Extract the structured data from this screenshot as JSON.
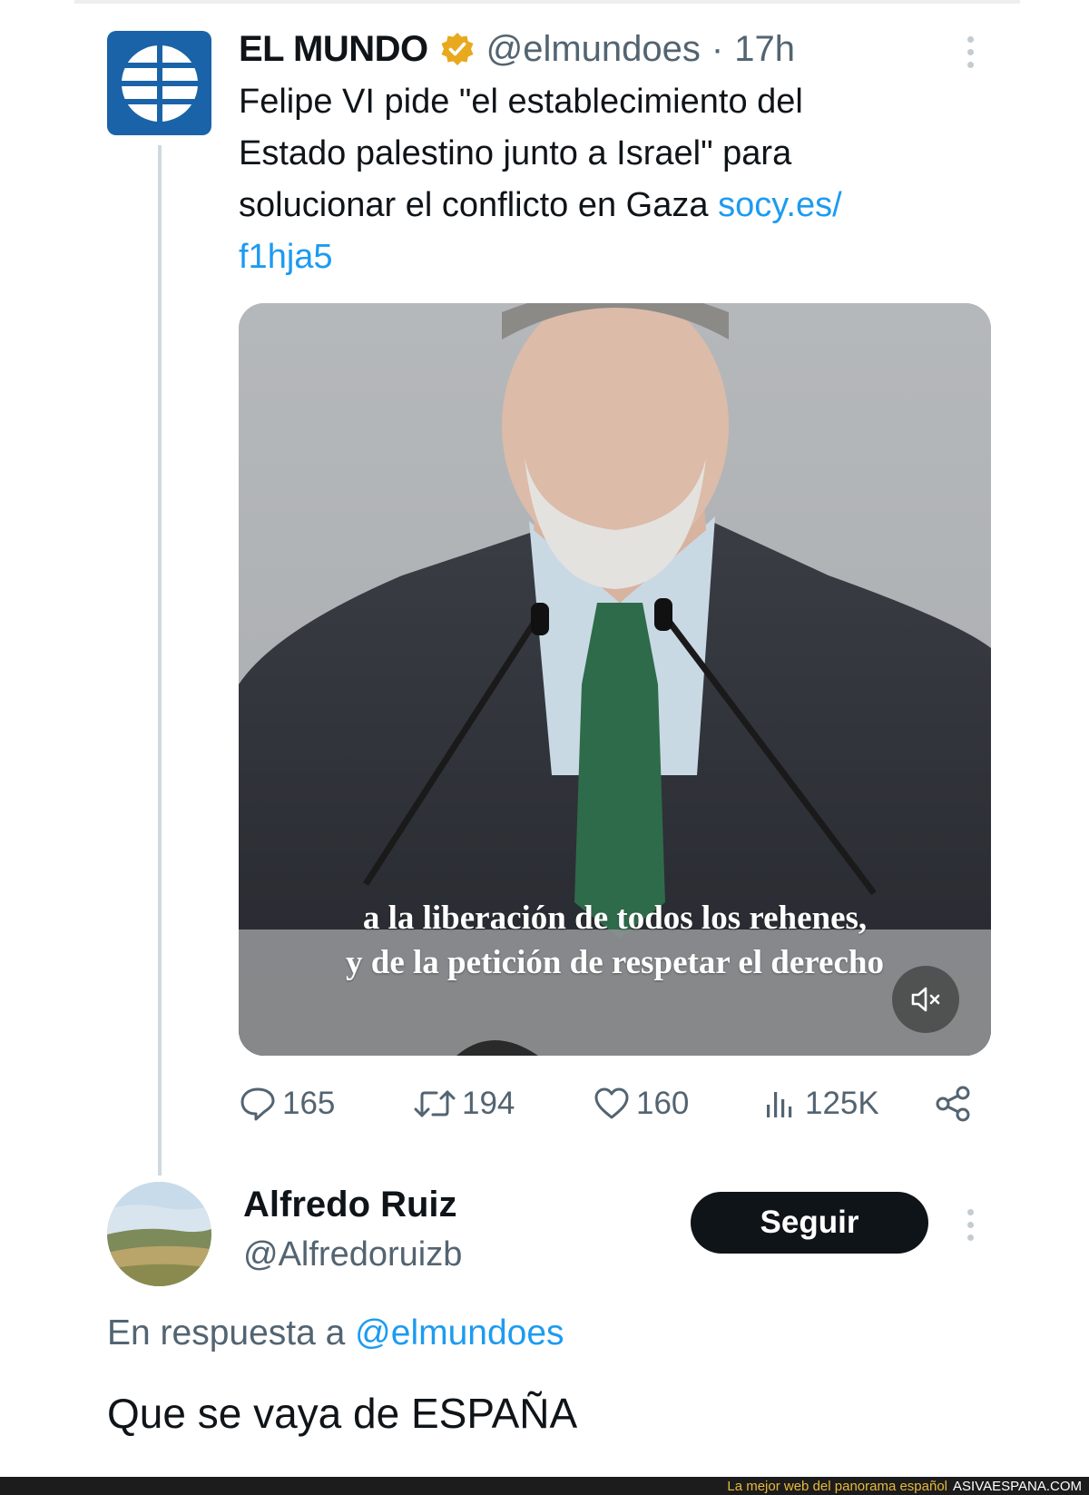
{
  "tweet": {
    "author_name": "EL MUNDO",
    "author_handle": "@elmundoes",
    "separator": "·",
    "time": "17h",
    "text_line1": "Felipe VI pide \"el establecimiento del",
    "text_line2": "Estado palestino junto a Israel\" para",
    "text_line3": "solucionar el conflicto en Gaza ",
    "link_part1": "socy.es/",
    "link_part2": "f1hja5",
    "video_caption_line1": "a la liberación de todos los rehenes,",
    "video_caption_line2": "y de la petición de respetar el derecho",
    "stats": {
      "replies": "165",
      "retweets": "194",
      "likes": "160",
      "views": "125K"
    }
  },
  "reply": {
    "author_name": "Alfredo Ruiz",
    "author_handle": "@Alfredoruizb",
    "follow_label": "Seguir",
    "in_reply_prefix": "En respuesta a ",
    "in_reply_handle": "@elmundoes",
    "text": "Que se vaya de ESPAÑA"
  },
  "footer": {
    "tagline": "La mejor web del panorama español",
    "site": "ASIVAESPANA.COM"
  },
  "icons": {
    "verified": "verified-badge-icon",
    "reply": "reply-icon",
    "retweet": "retweet-icon",
    "like": "heart-icon",
    "views": "views-icon",
    "share": "share-icon",
    "mute": "muted-speaker-icon",
    "more": "more-options-icon"
  },
  "colors": {
    "link": "#1d9bf0",
    "verified": "#e8a91f",
    "brand_el_mundo": "#1b63a8",
    "secondary_text": "#536471",
    "button": "#0f1419"
  }
}
